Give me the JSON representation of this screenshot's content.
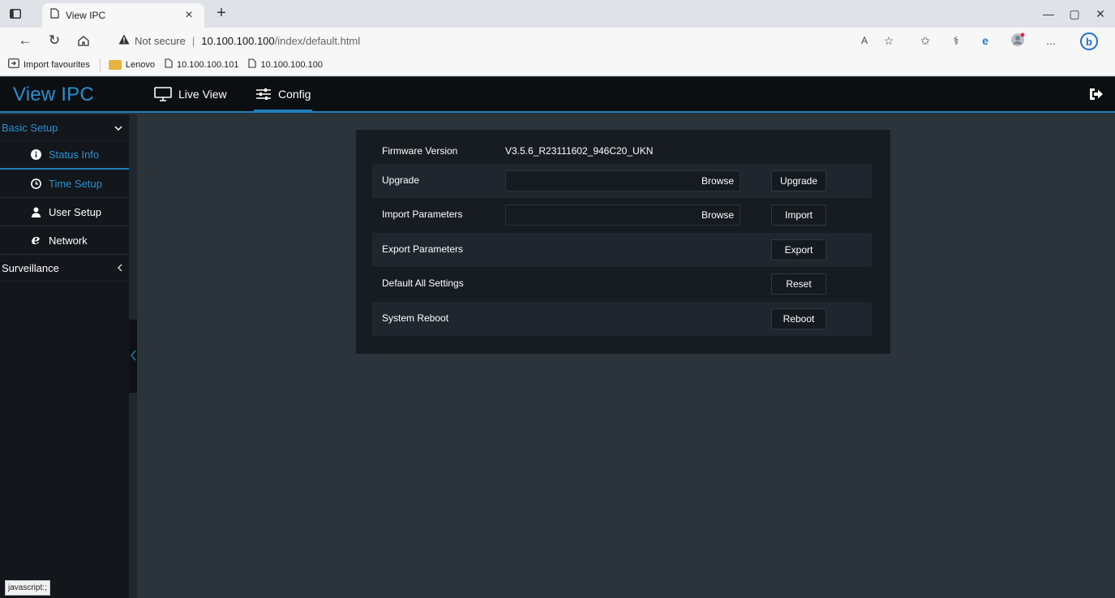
{
  "browser": {
    "tab_title": "View IPC",
    "tab_close": "×",
    "new_tab": "+",
    "address": {
      "warning": "Not secure",
      "separator": "|",
      "host": "10.100.100.100",
      "path": "/index/default.html"
    },
    "bookmarks": [
      {
        "label": "Import favourites",
        "icon": "import-icon"
      },
      {
        "label": "Lenovo",
        "icon": "folder-icon"
      },
      {
        "label": "10.100.100.101",
        "icon": "page-icon"
      },
      {
        "label": "10.100.100.100",
        "icon": "page-icon"
      }
    ],
    "read_aloud": "A",
    "more": "...",
    "status_url": "javascript:;"
  },
  "app": {
    "logo": "View IPC",
    "menu": [
      {
        "label": "Live View",
        "icon": "monitor-icon"
      },
      {
        "label": "Config",
        "icon": "sliders-icon"
      }
    ],
    "accent": "#1f7fb8"
  },
  "sidebar": {
    "sections": [
      {
        "label": "Basic Setup",
        "expanded": true,
        "items": [
          {
            "label": "Status Info",
            "icon": "info-icon"
          },
          {
            "label": "Time Setup",
            "icon": "clock-icon"
          },
          {
            "label": "User Setup",
            "icon": "user-icon"
          },
          {
            "label": "Network",
            "icon": "network-ie-icon"
          }
        ]
      },
      {
        "label": "Surveillance",
        "expanded": false
      }
    ]
  },
  "main": {
    "rows": [
      {
        "label": "Firmware Version",
        "value": "V3.5.6_R23111602_946C20_UKN"
      },
      {
        "label": "Upgrade",
        "browse": "Browse",
        "action": "Upgrade"
      },
      {
        "label": "Import Parameters",
        "browse": "Browse",
        "action": "Import"
      },
      {
        "label": "Export Parameters",
        "action": "Export"
      },
      {
        "label": "Default All Settings",
        "action": "Reset"
      },
      {
        "label": "System Reboot",
        "action": "Reboot"
      }
    ]
  }
}
